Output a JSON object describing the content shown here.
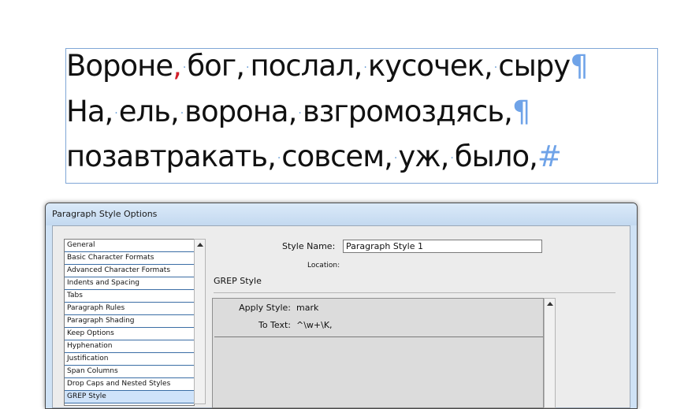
{
  "document_text": {
    "line1": {
      "words": [
        "Вороне",
        "бог",
        "послал",
        "кусочек",
        "сыру"
      ],
      "end_mark": "¶"
    },
    "line2": {
      "words": [
        "На",
        "ель",
        "ворона",
        "взгромоздясь"
      ],
      "end_mark": "¶"
    },
    "line3": {
      "words": [
        "позавтракать",
        "совсем",
        "уж",
        "было"
      ],
      "end_mark": "#"
    },
    "comma": ",",
    "space_marker": "·",
    "colors": {
      "mark_comma": "#d21f2a",
      "hidden_chars": "#6fa3e8"
    }
  },
  "dialog": {
    "title": "Paragraph Style Options",
    "categories": [
      "General",
      "Basic Character Formats",
      "Advanced Character Formats",
      "Indents and Spacing",
      "Tabs",
      "Paragraph Rules",
      "Paragraph Shading",
      "Keep Options",
      "Hyphenation",
      "Justification",
      "Span Columns",
      "Drop Caps and Nested Styles",
      "GREP Style"
    ],
    "selected_category": "GREP Style",
    "style_name_label": "Style Name:",
    "style_name_value": "Paragraph Style 1",
    "location_label": "Location:",
    "section_title": "GREP Style",
    "grep": {
      "apply_style_label": "Apply Style:",
      "apply_style_value": "mark",
      "to_text_label": "To Text:",
      "to_text_value": "^\\w+\\K,"
    }
  }
}
